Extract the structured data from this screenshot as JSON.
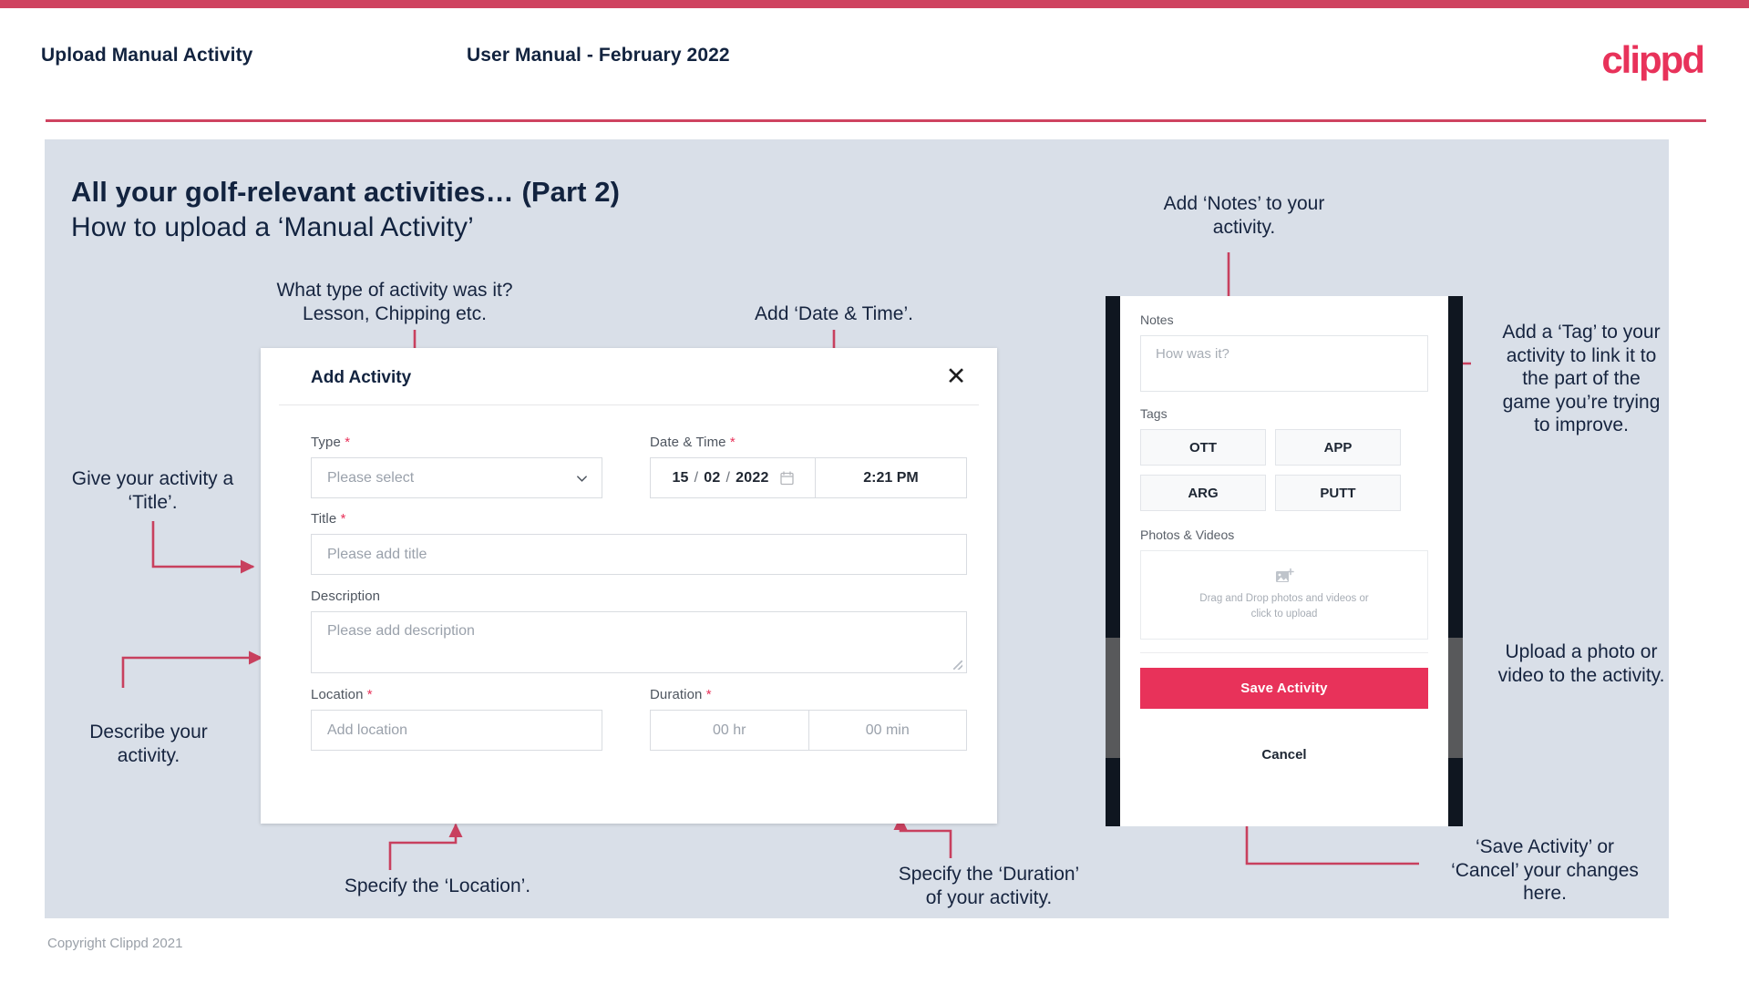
{
  "header": {
    "left_title": "Upload Manual Activity",
    "center_title": "User Manual - February 2022",
    "logo": "clippd"
  },
  "slide": {
    "title": "All your golf-relevant activities… (Part 2)",
    "subtitle": "How to upload a ‘Manual Activity’"
  },
  "footer": {
    "copyright": "Copyright Clippd 2021"
  },
  "colors": {
    "brand_pink": "#e8325a",
    "brand_bar": "#cf4360",
    "slide_bg": "#d9dfe8",
    "ink": "#12233f",
    "arrow": "#c8405e"
  },
  "modal": {
    "title": "Add Activity",
    "close_icon": "close-icon",
    "fields": {
      "type": {
        "label": "Type",
        "required": "*",
        "placeholder": "Please select",
        "chevron_icon": "chevron-down-icon"
      },
      "datetime": {
        "label": "Date & Time",
        "required": "*",
        "day": "15",
        "sep1": "/",
        "month": "02",
        "sep2": "/",
        "year": "2022",
        "calendar_icon": "calendar-icon",
        "time": "2:21 PM"
      },
      "title": {
        "label": "Title",
        "required": "*",
        "placeholder": "Please add title"
      },
      "description": {
        "label": "Description",
        "required": "",
        "placeholder": "Please add description"
      },
      "location": {
        "label": "Location",
        "required": "*",
        "placeholder": "Add location"
      },
      "duration": {
        "label": "Duration",
        "required": "*",
        "hours_placeholder": "00 hr",
        "minutes_placeholder": "00 min"
      }
    }
  },
  "phone": {
    "notes": {
      "label": "Notes",
      "placeholder": "How was it?"
    },
    "tags": {
      "label": "Tags",
      "items": [
        "OTT",
        "APP",
        "ARG",
        "PUTT"
      ]
    },
    "photos": {
      "label": "Photos & Videos",
      "upload_icon": "add-image-icon",
      "dropzone_line1": "Drag and Drop photos and videos or",
      "dropzone_line2": "click to upload"
    },
    "save_label": "Save Activity",
    "cancel_label": "Cancel"
  },
  "annotations": {
    "type": "What type of activity was it?\nLesson, Chipping etc.",
    "datetime": "Add ‘Date & Time’.",
    "title": "Give your activity a\n‘Title’.",
    "description": "Describe your\nactivity.",
    "location": "Specify the ‘Location’.",
    "duration": "Specify the ‘Duration’\nof your activity.",
    "notes": "Add ‘Notes’ to your\nactivity.",
    "tags": "Add a ‘Tag’ to your\nactivity to link it to\nthe part of the\ngame you’re trying\nto improve.",
    "photos": "Upload a photo or\nvideo to the activity.",
    "save": "‘Save Activity’ or\n‘Cancel’ your changes\nhere."
  }
}
